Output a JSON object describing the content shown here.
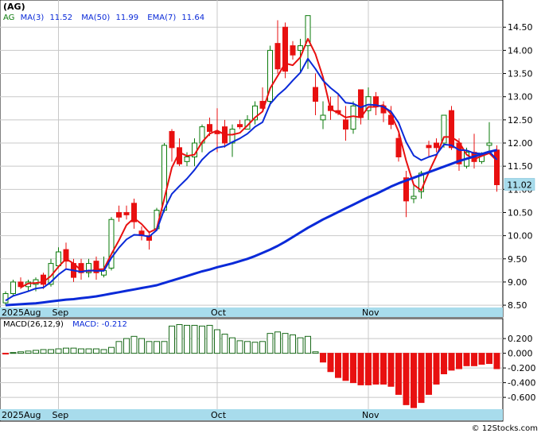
{
  "chart_data": [
    {
      "type": "candlestick",
      "title": "(AG)",
      "legend": {
        "symbol": "AG",
        "ma3_label": "MA(3)",
        "ma3_value": "11.52",
        "ma50_label": "MA(50)",
        "ma50_value": "11.99",
        "ema7_label": "EMA(7)",
        "ema7_value": "11.64"
      },
      "last_price_label": "11.02",
      "ylim": [
        8.45,
        14.95
      ],
      "yticks": [
        "14.50",
        "14.00",
        "13.50",
        "13.00",
        "12.50",
        "12.00",
        "11.50",
        "11.00",
        "10.50",
        "10.00",
        "9.50",
        "9.00",
        "8.50"
      ],
      "ytick_values": [
        14.5,
        14.0,
        13.5,
        13.0,
        12.5,
        12.0,
        11.5,
        11.0,
        10.5,
        10.0,
        9.5,
        9.0,
        8.5
      ],
      "month_labels": [
        {
          "text": "2025Aug",
          "index": 0
        },
        {
          "text": "Sep",
          "index": 7
        },
        {
          "text": "Oct",
          "index": 28
        },
        {
          "text": "Nov",
          "index": 48
        }
      ],
      "ohlc": [
        [
          8.55,
          8.8,
          8.5,
          8.75
        ],
        [
          8.75,
          9.05,
          8.7,
          9.0
        ],
        [
          9.0,
          9.1,
          8.85,
          8.9
        ],
        [
          8.9,
          9.05,
          8.8,
          9.0
        ],
        [
          8.95,
          9.1,
          8.8,
          9.05
        ],
        [
          9.15,
          9.2,
          8.85,
          8.95
        ],
        [
          8.95,
          9.5,
          8.9,
          9.4
        ],
        [
          9.35,
          9.75,
          9.3,
          9.65
        ],
        [
          9.7,
          9.85,
          9.3,
          9.45
        ],
        [
          9.4,
          9.5,
          9.0,
          9.1
        ],
        [
          9.4,
          9.5,
          9.05,
          9.2
        ],
        [
          9.2,
          9.5,
          9.1,
          9.4
        ],
        [
          9.45,
          9.55,
          9.05,
          9.2
        ],
        [
          9.15,
          9.55,
          9.1,
          9.25
        ],
        [
          9.3,
          10.4,
          9.25,
          10.35
        ],
        [
          10.5,
          10.65,
          10.3,
          10.4
        ],
        [
          10.5,
          10.65,
          10.35,
          10.45
        ],
        [
          10.7,
          10.8,
          10.15,
          10.3
        ],
        [
          10.1,
          10.2,
          9.9,
          10.0
        ],
        [
          10.0,
          10.1,
          9.7,
          9.9
        ],
        [
          10.15,
          10.6,
          10.1,
          10.55
        ],
        [
          10.55,
          12.0,
          10.5,
          11.95
        ],
        [
          12.25,
          12.3,
          11.6,
          11.9
        ],
        [
          11.9,
          12.1,
          11.5,
          11.55
        ],
        [
          11.6,
          11.8,
          11.5,
          11.7
        ],
        [
          11.7,
          12.1,
          11.5,
          12.0
        ],
        [
          12.0,
          12.4,
          11.8,
          12.35
        ],
        [
          12.4,
          12.55,
          12.15,
          12.25
        ],
        [
          12.25,
          12.75,
          11.8,
          12.2
        ],
        [
          12.35,
          12.5,
          11.9,
          12.0
        ],
        [
          12.0,
          12.4,
          11.7,
          12.3
        ],
        [
          12.4,
          12.5,
          12.3,
          12.35
        ],
        [
          12.3,
          12.6,
          12.3,
          12.5
        ],
        [
          12.5,
          12.9,
          12.4,
          12.8
        ],
        [
          12.9,
          13.2,
          12.7,
          12.75
        ],
        [
          12.9,
          14.1,
          12.8,
          14.0
        ],
        [
          14.15,
          14.65,
          13.5,
          13.6
        ],
        [
          14.5,
          14.6,
          13.4,
          13.55
        ],
        [
          14.1,
          14.2,
          13.8,
          13.9
        ],
        [
          14.0,
          14.25,
          13.5,
          14.1
        ],
        [
          14.1,
          14.75,
          13.6,
          14.75
        ],
        [
          13.2,
          13.5,
          12.6,
          12.9
        ],
        [
          12.5,
          12.9,
          12.3,
          12.6
        ],
        [
          12.8,
          13.0,
          12.5,
          12.7
        ],
        [
          12.7,
          13.05,
          12.6,
          12.65
        ],
        [
          12.5,
          12.8,
          12.05,
          12.3
        ],
        [
          12.3,
          12.9,
          12.2,
          12.8
        ],
        [
          13.15,
          13.15,
          12.4,
          12.55
        ],
        [
          12.7,
          13.2,
          12.5,
          13.0
        ],
        [
          13.0,
          13.1,
          12.6,
          12.8
        ],
        [
          12.8,
          12.9,
          12.45,
          12.65
        ],
        [
          12.6,
          12.8,
          12.3,
          12.4
        ],
        [
          12.1,
          12.2,
          11.6,
          11.7
        ],
        [
          11.25,
          11.4,
          10.4,
          10.75
        ],
        [
          10.8,
          11.1,
          10.7,
          10.85
        ],
        [
          10.95,
          11.4,
          10.8,
          11.35
        ],
        [
          11.95,
          12.05,
          11.7,
          11.9
        ],
        [
          12.0,
          12.1,
          11.8,
          11.9
        ],
        [
          12.0,
          12.6,
          11.9,
          12.6
        ],
        [
          12.7,
          12.8,
          11.85,
          11.9
        ],
        [
          12.0,
          12.1,
          11.4,
          11.55
        ],
        [
          11.5,
          11.9,
          11.45,
          11.8
        ],
        [
          11.8,
          12.2,
          11.45,
          11.6
        ],
        [
          11.6,
          11.8,
          11.55,
          11.75
        ],
        [
          11.95,
          12.45,
          11.8,
          12.0
        ],
        [
          11.85,
          11.95,
          10.95,
          11.1
        ]
      ],
      "series": [
        {
          "name": "MA(3)",
          "color": "#e81010",
          "line_width": 2,
          "values": [
            null,
            null,
            8.88,
            8.97,
            8.98,
            9.0,
            9.13,
            9.33,
            9.5,
            9.4,
            9.25,
            9.23,
            9.27,
            9.28,
            9.6,
            9.9,
            10.23,
            10.38,
            10.25,
            10.07,
            10.15,
            10.8,
            11.47,
            11.8,
            11.72,
            11.75,
            12.02,
            12.2,
            12.27,
            12.18,
            12.18,
            12.22,
            12.38,
            12.55,
            12.68,
            13.18,
            13.45,
            13.72,
            13.68,
            13.85,
            14.25,
            13.92,
            13.42,
            12.73,
            12.65,
            12.55,
            12.58,
            12.55,
            12.78,
            12.78,
            12.82,
            12.62,
            12.25,
            11.62,
            11.1,
            10.98,
            11.37,
            11.72,
            12.13,
            12.13,
            12.02,
            11.75,
            11.65,
            11.72,
            11.78,
            11.62
          ]
        },
        {
          "name": "EMA(7)",
          "color": "#0a2ad8",
          "line_width": 2,
          "values": [
            8.6,
            8.7,
            8.75,
            8.8,
            8.86,
            8.88,
            9.0,
            9.16,
            9.28,
            9.25,
            9.22,
            9.25,
            9.24,
            9.24,
            9.52,
            9.74,
            9.92,
            10.02,
            10.01,
            9.98,
            10.12,
            10.57,
            10.9,
            11.07,
            11.23,
            11.42,
            11.64,
            11.8,
            11.9,
            11.93,
            12.02,
            12.1,
            12.2,
            12.35,
            12.45,
            12.84,
            13.03,
            13.17,
            13.35,
            13.52,
            13.82,
            13.6,
            13.35,
            13.19,
            13.06,
            12.87,
            12.85,
            12.77,
            12.83,
            12.82,
            12.78,
            12.68,
            12.44,
            12.02,
            11.73,
            11.63,
            11.7,
            11.75,
            11.97,
            11.95,
            11.85,
            11.84,
            11.78,
            11.77,
            11.82,
            11.64
          ]
        },
        {
          "name": "MA(50)",
          "color": "#0a2ad8",
          "line_width": 3,
          "values": [
            8.5,
            8.51,
            8.52,
            8.53,
            8.54,
            8.56,
            8.58,
            8.6,
            8.62,
            8.63,
            8.65,
            8.67,
            8.69,
            8.72,
            8.75,
            8.78,
            8.81,
            8.84,
            8.87,
            8.9,
            8.93,
            8.98,
            9.03,
            9.08,
            9.13,
            9.18,
            9.23,
            9.27,
            9.32,
            9.36,
            9.4,
            9.45,
            9.5,
            9.56,
            9.63,
            9.7,
            9.78,
            9.87,
            9.97,
            10.07,
            10.17,
            10.26,
            10.35,
            10.43,
            10.51,
            10.59,
            10.67,
            10.75,
            10.83,
            10.9,
            10.98,
            11.06,
            11.13,
            11.19,
            11.25,
            11.31,
            11.37,
            11.43,
            11.49,
            11.55,
            11.61,
            11.66,
            11.71,
            11.76,
            11.81,
            11.85
          ]
        }
      ]
    },
    {
      "type": "bar",
      "legend": {
        "label": "MACD(26,12,9)",
        "value_label": "MACD:",
        "value": "-0.212"
      },
      "ylim": [
        -0.75,
        0.32
      ],
      "yticks": [
        "0.200",
        "0.000",
        "-0.200",
        "-0.400",
        "-0.600"
      ],
      "ytick_values": [
        0.2,
        0.0,
        -0.2,
        -0.4,
        -0.6
      ],
      "month_labels": [
        {
          "text": "2025Aug",
          "index": 0
        },
        {
          "text": "Sep",
          "index": 7
        },
        {
          "text": "Oct",
          "index": 28
        },
        {
          "text": "Nov",
          "index": 48
        }
      ],
      "values": [
        -0.01,
        0.01,
        0.02,
        0.03,
        0.04,
        0.05,
        0.05,
        0.06,
        0.07,
        0.07,
        0.06,
        0.06,
        0.06,
        0.05,
        0.08,
        0.16,
        0.2,
        0.23,
        0.2,
        0.16,
        0.16,
        0.16,
        0.37,
        0.39,
        0.38,
        0.38,
        0.37,
        0.38,
        0.32,
        0.26,
        0.21,
        0.17,
        0.16,
        0.15,
        0.16,
        0.27,
        0.29,
        0.27,
        0.25,
        0.21,
        0.23,
        0.02,
        -0.12,
        -0.25,
        -0.33,
        -0.37,
        -0.4,
        -0.43,
        -0.43,
        -0.42,
        -0.42,
        -0.45,
        -0.56,
        -0.7,
        -0.74,
        -0.67,
        -0.56,
        -0.42,
        -0.28,
        -0.23,
        -0.21,
        -0.17,
        -0.17,
        -0.15,
        -0.14,
        -0.21
      ]
    }
  ],
  "footer": {
    "text": "© 12Stocks.com"
  },
  "colors": {
    "up": "#0a7a0a",
    "down": "#e81010",
    "band": "#a8dcec",
    "grid": "#c8c8c8",
    "tag_bg": "#a8dcec",
    "macd_up": "#1a6a1a",
    "macd_down": "#e81010"
  }
}
